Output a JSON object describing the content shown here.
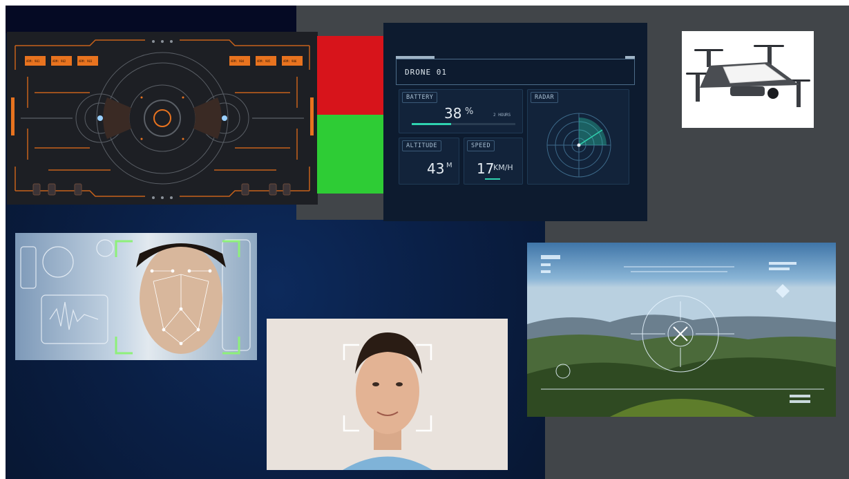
{
  "hud": {
    "top_labels": [
      "ARM: 901",
      "ARM: 902",
      "ARM: 903",
      "ARM: 904",
      "ARM: 905",
      "ARM: 906"
    ]
  },
  "dashboard": {
    "title": "DRONE 01",
    "battery": {
      "label": "BATTERY",
      "value": "38",
      "unit": "%",
      "time_label": "2 HOURS",
      "level": 0.38
    },
    "radar": {
      "label": "RADAR"
    },
    "altitude": {
      "label": "ALTITUDE",
      "value": "43",
      "unit": "M"
    },
    "speed": {
      "label": "SPEED",
      "value": "17",
      "unit": "KM/H"
    }
  },
  "colors": {
    "hud_accent": "#e8731f",
    "dash_accent": "#2fd3b0",
    "red_block": "#d7141b",
    "green_block": "#2ecc35",
    "face_frame": "#8ef07a"
  },
  "icons": [
    "drone-icon",
    "face-scan-icon",
    "crosshair-icon",
    "radar-icon"
  ]
}
